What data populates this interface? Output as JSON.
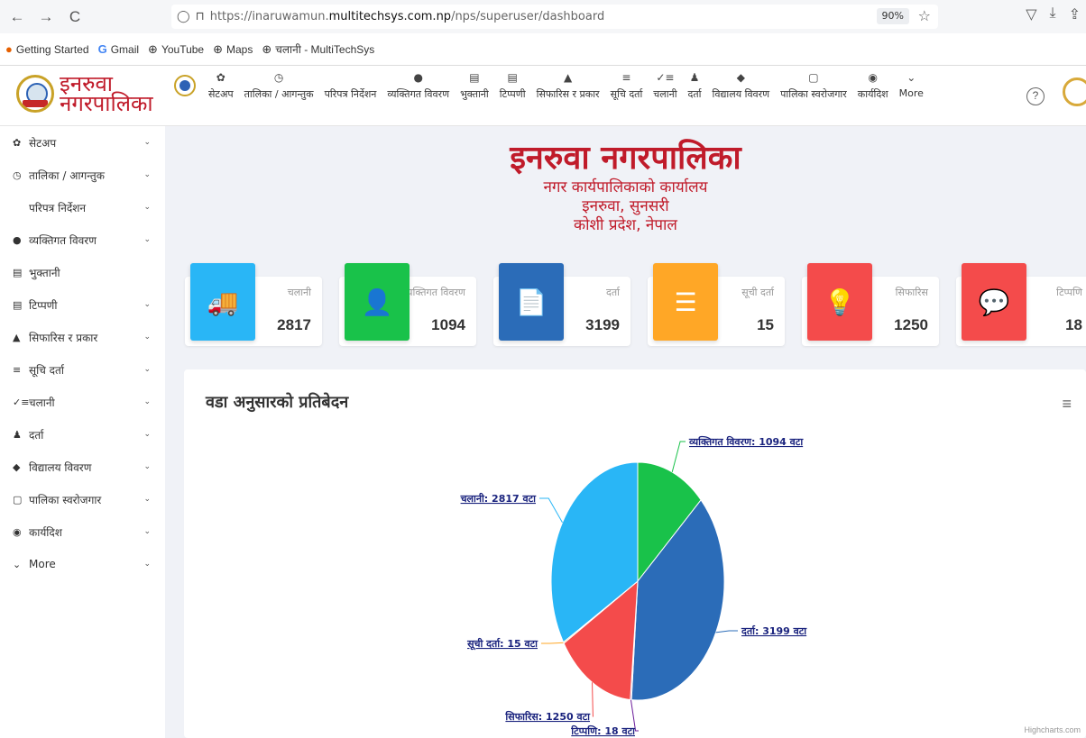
{
  "browser": {
    "back": "←",
    "forward": "→",
    "reload": "C",
    "url_prefix": "https://inaruwamun.",
    "url_domain": "multitechsys.com.np",
    "url_path": "/nps/superuser/dashboard",
    "zoom": "90%"
  },
  "bookmarks": [
    {
      "icon": "●",
      "label": "Getting Started"
    },
    {
      "icon": "G",
      "label": "Gmail"
    },
    {
      "icon": "⊕",
      "label": "YouTube"
    },
    {
      "icon": "⊕",
      "label": "Maps"
    },
    {
      "icon": "⊕",
      "label": "चलानी - MultiTechSys"
    }
  ],
  "logo": {
    "line1": "इनरुवा",
    "line2": "नगरपालिका"
  },
  "topnav": [
    {
      "icon": "✿",
      "label": "सेटअप"
    },
    {
      "icon": "◷",
      "label": "तालिका / आगन्तुक"
    },
    {
      "icon": "",
      "label": "परिपत्र निर्देशन"
    },
    {
      "icon": "●",
      "label": "व्यक्तिगत विवरण"
    },
    {
      "icon": "▤",
      "label": "भुक्तानी"
    },
    {
      "icon": "▤",
      "label": "टिप्पणी"
    },
    {
      "icon": "▲",
      "label": "सिफारिस र प्रकार"
    },
    {
      "icon": "≡",
      "label": "सूचि दर्ता"
    },
    {
      "icon": "✓≡",
      "label": "चलानी"
    },
    {
      "icon": "♟",
      "label": "दर्ता"
    },
    {
      "icon": "◆",
      "label": "विद्यालय विवरण"
    },
    {
      "icon": "▢",
      "label": "पालिका स्वरोजगार"
    },
    {
      "icon": "◉",
      "label": "कार्यदिश"
    },
    {
      "icon": "⌄",
      "label": "More"
    }
  ],
  "sidebar": [
    {
      "icon": "✿",
      "label": "सेटअप",
      "chevron": "⌄"
    },
    {
      "icon": "◷",
      "label": "तालिका / आगन्तुक",
      "chevron": "⌄"
    },
    {
      "icon": "",
      "label": "परिपत्र निर्देशन",
      "chevron": "⌄"
    },
    {
      "icon": "●",
      "label": "व्यक्तिगत विवरण",
      "chevron": "⌄"
    },
    {
      "icon": "▤",
      "label": "भुक्तानी",
      "chevron": ""
    },
    {
      "icon": "▤",
      "label": "टिप्पणी",
      "chevron": "⌄"
    },
    {
      "icon": "▲",
      "label": "सिफारिस र प्रकार",
      "chevron": "⌄"
    },
    {
      "icon": "≡",
      "label": "सूचि दर्ता",
      "chevron": "⌄"
    },
    {
      "icon": "✓≡",
      "label": "चलानी",
      "chevron": "⌄"
    },
    {
      "icon": "♟",
      "label": "दर्ता",
      "chevron": "⌄"
    },
    {
      "icon": "◆",
      "label": "विद्यालय विवरण",
      "chevron": "⌄"
    },
    {
      "icon": "▢",
      "label": "पालिका स्वरोजगार",
      "chevron": "⌄"
    },
    {
      "icon": "◉",
      "label": "कार्यदिश",
      "chevron": "⌄"
    },
    {
      "icon": "⌄",
      "label": "More",
      "chevron": "⌄"
    }
  ],
  "org": {
    "title": "इनरुवा नगरपालिका",
    "line1": "नगर कार्यपालिकाको कार्यालय",
    "line2": "इनरुवा, सुनसरी",
    "line3": "कोशी प्रदेश, नेपाल"
  },
  "stats": [
    {
      "label": "चलानी",
      "value": "2817",
      "color": "#29b6f6",
      "icon": "🚚"
    },
    {
      "label": "व्यक्तिगत विवरण",
      "value": "1094",
      "color": "#19c24a",
      "icon": "👤"
    },
    {
      "label": "दर्ता",
      "value": "3199",
      "color": "#2b6cb8",
      "icon": "📄"
    },
    {
      "label": "सूची दर्ता",
      "value": "15",
      "color": "#ffa726",
      "icon": "☰"
    },
    {
      "label": "सिफारिस",
      "value": "1250",
      "color": "#f44b4b",
      "icon": "💡"
    },
    {
      "label": "टिप्पणि",
      "value": "18",
      "color": "#f44b4b",
      "icon": "💬"
    }
  ],
  "report": {
    "title": "वडा अनुसारको प्रतिबेदन",
    "menu": "≡",
    "credit": "Highcharts.com"
  },
  "chart_data": {
    "type": "pie",
    "title": "",
    "series": [
      {
        "name": "व्यक्तिगत विवरण",
        "value": 1094,
        "label": "व्यक्तिगत विवरण: 1094 वटा",
        "color": "#19c24a"
      },
      {
        "name": "दर्ता",
        "value": 3199,
        "label": "दर्ता: 3199 वटा",
        "color": "#2b6cb8"
      },
      {
        "name": "टिप्पणि",
        "value": 18,
        "label": "टिप्पणि: 18 वटा",
        "color": "#6a1b9a"
      },
      {
        "name": "सिफारिस",
        "value": 1250,
        "label": "सिफारिस: 1250 वटा",
        "color": "#f44b4b"
      },
      {
        "name": "सूची दर्ता",
        "value": 15,
        "label": "सूची दर्ता: 15 वटा",
        "color": "#ffa726"
      },
      {
        "name": "चलानी",
        "value": 2817,
        "label": "चलानी: 2817 वटा",
        "color": "#29b6f6"
      }
    ]
  }
}
